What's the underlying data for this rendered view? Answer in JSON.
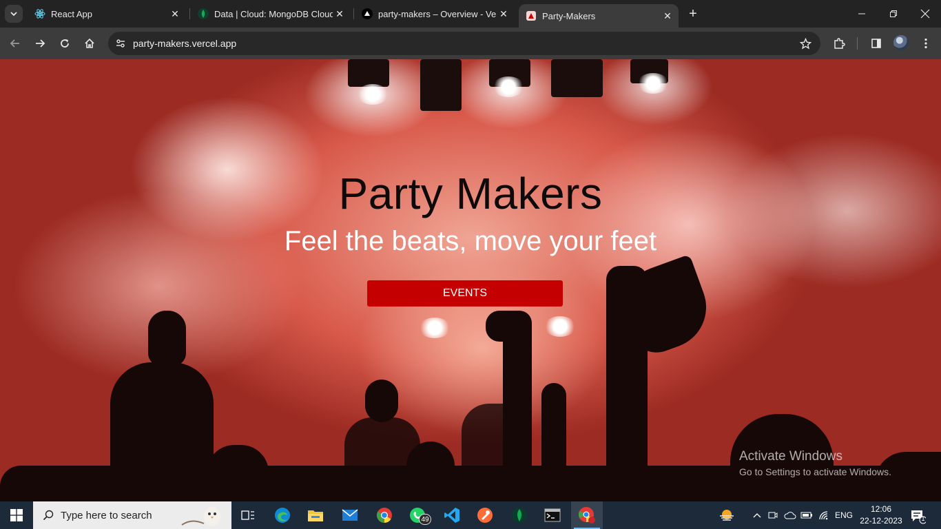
{
  "browser": {
    "tabs": [
      {
        "title": "React App",
        "favicon": "react-icon",
        "active": false
      },
      {
        "title": "Data | Cloud: MongoDB Cloud",
        "favicon": "mongodb-leaf-icon",
        "active": false
      },
      {
        "title": "party-makers – Overview - Verc",
        "favicon": "vercel-triangle-icon",
        "active": false
      },
      {
        "title": "Party-Makers",
        "favicon": "party-makers-icon",
        "active": true
      }
    ],
    "new_tab_label": "+",
    "address": "party-makers.vercel.app"
  },
  "page": {
    "title": "Party Makers",
    "subtitle": "Feel the beats, move your feet",
    "events_button": "EVENTS",
    "accent_color": "#c40000"
  },
  "watermark": {
    "line1": "Activate Windows",
    "line2": "Go to Settings to activate Windows."
  },
  "taskbar": {
    "search_placeholder": "Type here to search",
    "apps": [
      "task-view-icon",
      "edge-icon",
      "file-explorer-icon",
      "mail-icon",
      "chrome-icon",
      "whatsapp-icon",
      "vscode-icon",
      "postman-icon",
      "mongodb-compass-icon",
      "terminal-icon",
      "chrome-profile-icon"
    ],
    "whatsapp_badge": "49",
    "language": "ENG",
    "time": "12:06",
    "date": "22-12-2023",
    "notification_count": "1"
  }
}
